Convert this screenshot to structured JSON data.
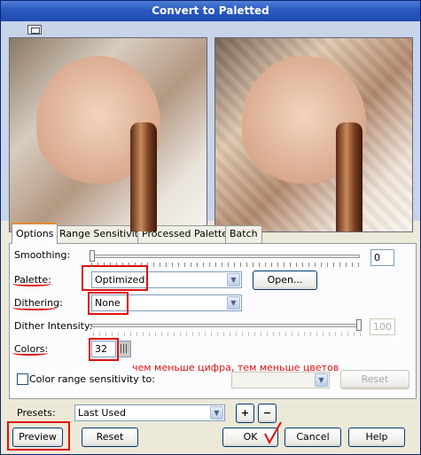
{
  "window": {
    "title": "Convert to Paletted"
  },
  "tabs": [
    "Options",
    "Range Sensitivity",
    "Processed Palette",
    "Batch"
  ],
  "options": {
    "smoothing_label": "Smoothing:",
    "smoothing_value": "0",
    "smoothing_level": 0,
    "palette_label": "Palette:",
    "palette_value": "Optimized",
    "open_button": "Open...",
    "dithering_label": "Dithering:",
    "dithering_value": "None",
    "dither_intensity_label": "Dither Intensity:",
    "dither_intensity_value": "100",
    "dither_intensity_level": 1.0,
    "colors_label": "Colors:",
    "colors_value": "32",
    "annotation": "чем меньше цифра, тем меньше цветов",
    "color_range_label": "Color range sensitivity to:",
    "reset_label": "Reset"
  },
  "presets": {
    "label": "Presets:",
    "value": "Last Used",
    "add": "+",
    "remove": "−"
  },
  "buttons": {
    "preview": "Preview",
    "reset": "Reset",
    "ok": "OK",
    "cancel": "Cancel",
    "help": "Help"
  },
  "colors": {
    "annotation_red": "#e01010",
    "titlebar": "#2a58c0"
  }
}
